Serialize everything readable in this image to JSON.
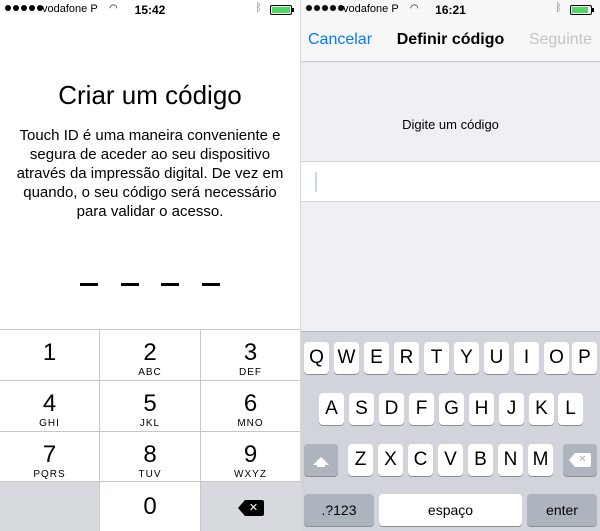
{
  "left": {
    "status": {
      "carrier": "vodafone P",
      "time": "15:42"
    },
    "title": "Criar um código",
    "description": "Touch ID é uma maneira conveniente e segura de aceder ao seu dispositivo através da impressão digital. De vez em quando, o seu código será necessário para validar o acesso.",
    "keypad": [
      {
        "num": "1",
        "letters": ""
      },
      {
        "num": "2",
        "letters": "ABC"
      },
      {
        "num": "3",
        "letters": "DEF"
      },
      {
        "num": "4",
        "letters": "GHI"
      },
      {
        "num": "5",
        "letters": "JKL"
      },
      {
        "num": "6",
        "letters": "MNO"
      },
      {
        "num": "7",
        "letters": "PQRS"
      },
      {
        "num": "8",
        "letters": "TUV"
      },
      {
        "num": "9",
        "letters": "WXYZ"
      },
      {
        "num": "0",
        "letters": ""
      }
    ]
  },
  "right": {
    "status": {
      "carrier": "vodafone P",
      "time": "16:21"
    },
    "nav": {
      "cancel": "Cancelar",
      "title": "Definir código",
      "next": "Seguinte"
    },
    "prompt": "Digite um código",
    "keyboard": {
      "row1": [
        "Q",
        "W",
        "E",
        "R",
        "T",
        "Y",
        "U",
        "I",
        "O",
        "P"
      ],
      "row2": [
        "A",
        "S",
        "D",
        "F",
        "G",
        "H",
        "J",
        "K",
        "L"
      ],
      "row3": [
        "Z",
        "X",
        "C",
        "V",
        "B",
        "N",
        "M"
      ],
      "numbers_key": ".?123",
      "space_key": "espaço",
      "enter_key": "enter"
    }
  },
  "icons": {
    "wifi": "wifi-icon",
    "bluetooth": "bluetooth-icon",
    "battery": "battery-icon",
    "delete": "delete-icon",
    "shift": "shift-icon"
  },
  "colors": {
    "accent": "#007aff",
    "disabled": "#c4c4c4",
    "battery": "#4cd964",
    "keyboard_bg": "#d1d5db",
    "key_gray": "#adb4bd"
  }
}
